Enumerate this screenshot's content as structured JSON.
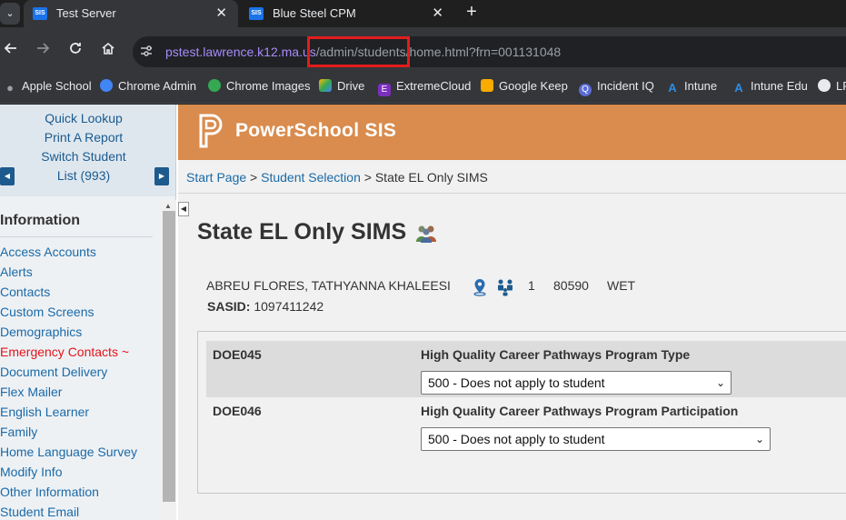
{
  "browser": {
    "tabs": [
      {
        "favicon": "SIS",
        "title": "Test Server",
        "active": true
      },
      {
        "favicon": "SIS",
        "title": "Blue Steel CPM",
        "active": false
      }
    ],
    "tab_search_icon": "chevron-down-icon",
    "close_glyph": "✕",
    "newtab_glyph": "+",
    "url": {
      "host": "pstest.lawrence.k12.ma.us",
      "path_highlight": "/admin/students/",
      "path_rest": "home.html?frn=001131048"
    },
    "bookmarks": [
      {
        "label": "Apple School",
        "color": "#9aa0a6"
      },
      {
        "label": "Chrome Admin",
        "color": "#4285f4"
      },
      {
        "label": "Chrome Images",
        "color": "#34a853"
      },
      {
        "label": "Drive",
        "color": "#fbbc04"
      },
      {
        "label": "ExtremeCloud",
        "color": "#7b2fbe"
      },
      {
        "label": "Google Keep",
        "color": "#f9ab00"
      },
      {
        "label": "Incident IQ",
        "color": "#5b6cd6"
      },
      {
        "label": "Intune",
        "color": "#2b8ee6"
      },
      {
        "label": "Intune Edu",
        "color": "#2b8ee6"
      },
      {
        "label": "LF",
        "color": "#e8eaed"
      }
    ]
  },
  "nav": {
    "quick_lookup": "Quick Lookup",
    "print_report": "Print A Report",
    "switch_student": "Switch Student",
    "list_count": "List (993)",
    "heading": "Information",
    "items": [
      {
        "label": "Access Accounts",
        "alert": false
      },
      {
        "label": "Alerts",
        "alert": false
      },
      {
        "label": "Contacts",
        "alert": false
      },
      {
        "label": "Custom Screens",
        "alert": false
      },
      {
        "label": "Demographics",
        "alert": false
      },
      {
        "label": "Emergency Contacts ~",
        "alert": true
      },
      {
        "label": "Document Delivery",
        "alert": false
      },
      {
        "label": "Flex Mailer",
        "alert": false
      },
      {
        "label": "English Learner",
        "alert": false
      },
      {
        "label": "Family",
        "alert": false
      },
      {
        "label": "Home Language Survey",
        "alert": false
      },
      {
        "label": "Modify Info",
        "alert": false
      },
      {
        "label": "Other Information",
        "alert": false
      },
      {
        "label": "Student Email",
        "alert": false
      }
    ]
  },
  "banner": {
    "brand": "PowerSchool SIS",
    "accent": "#d98c4e"
  },
  "breadcrumb": {
    "start": "Start Page",
    "sep": ">",
    "selection": "Student Selection",
    "current": "State EL Only SIMS"
  },
  "page": {
    "title": "State EL Only SIMS"
  },
  "student": {
    "name": "ABREU FLORES, TATHYANNA KHALEESI",
    "grade": "1",
    "id": "80590",
    "school": "WET",
    "sasid_label": "SASID:",
    "sasid": "1097411242"
  },
  "fields": [
    {
      "code": "DOE045",
      "label": "High Quality Career Pathways Program Type",
      "value": "500 - Does not apply to student"
    },
    {
      "code": "DOE046",
      "label": "High Quality Career Pathways Program Participation",
      "value": "500 - Does not apply to student"
    }
  ]
}
